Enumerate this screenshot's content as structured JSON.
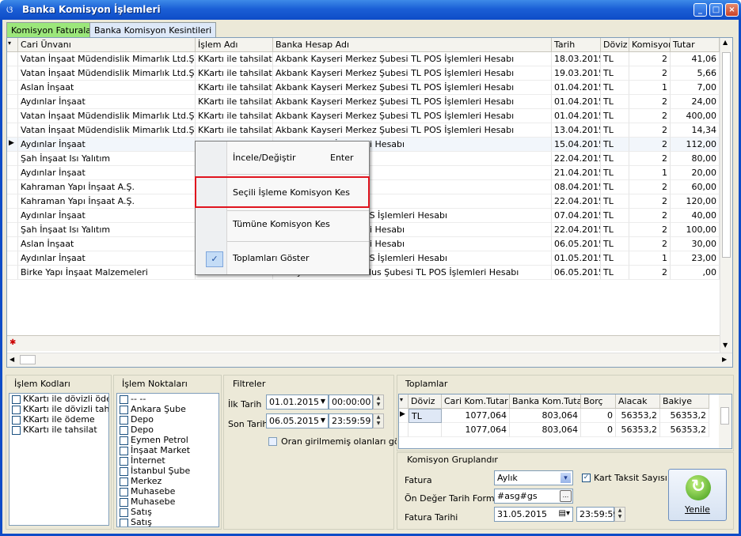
{
  "window": {
    "title": "Banka Komisyon İşlemleri",
    "app_icon": "butterfly-icon",
    "buttons": {
      "minimize": "_",
      "maximize": "□",
      "close": "×"
    }
  },
  "tabs": [
    {
      "label": "Komisyon Faturaları",
      "active": true
    },
    {
      "label": "Banka Komisyon Kesintileri",
      "active": false
    }
  ],
  "grid": {
    "columns": [
      "Cari Ünvanı",
      "İşlem Adı",
      "Banka Hesap Adı",
      "Tarih",
      "Döviz",
      "Komisyon",
      "Tutar"
    ],
    "rows": [
      {
        "cari": "Vatan İnşaat Müdendislik Mimarlık Ltd.Şti",
        "islem": "KKartı ile tahsilat",
        "banka": "Akbank Kayseri Merkez Şubesi TL POS İşlemleri Hesabı",
        "tarih": "18.03.2015",
        "doviz": "TL",
        "komisyon": "2",
        "tutar": "41,06"
      },
      {
        "cari": "Vatan İnşaat Müdendislik Mimarlık Ltd.Şti",
        "islem": "KKartı ile tahsilat",
        "banka": "Akbank Kayseri Merkez Şubesi TL POS İşlemleri Hesabı",
        "tarih": "19.03.2015",
        "doviz": "TL",
        "komisyon": "2",
        "tutar": "5,66"
      },
      {
        "cari": "Aslan İnşaat",
        "islem": "KKartı ile tahsilat",
        "banka": "Akbank Kayseri Merkez Şubesi TL POS İşlemleri Hesabı",
        "tarih": "01.04.2015",
        "doviz": "TL",
        "komisyon": "1",
        "tutar": "7,00"
      },
      {
        "cari": "Aydınlar İnşaat",
        "islem": "KKartı ile tahsilat",
        "banka": "Akbank Kayseri Merkez Şubesi TL POS İşlemleri Hesabı",
        "tarih": "01.04.2015",
        "doviz": "TL",
        "komisyon": "2",
        "tutar": "24,00"
      },
      {
        "cari": "Vatan İnşaat Müdendislik Mimarlık Ltd.Şti",
        "islem": "KKartı ile tahsilat",
        "banka": "Akbank Kayseri Merkez Şubesi TL POS İşlemleri Hesabı",
        "tarih": "01.04.2015",
        "doviz": "TL",
        "komisyon": "2",
        "tutar": "400,00"
      },
      {
        "cari": "Vatan İnşaat Müdendislik Mimarlık Ltd.Şti",
        "islem": "KKartı ile tahsilat",
        "banka": "Akbank Kayseri Merkez Şubesi TL POS İşlemleri Hesabı",
        "tarih": "13.04.2015",
        "doviz": "TL",
        "komisyon": "2",
        "tutar": "14,34"
      },
      {
        "cari": "Aydınlar İnşaat",
        "islem": "",
        "banka": "ubesi TL POS İşlemleri Hesabı",
        "tarih": "15.04.2015",
        "doviz": "TL",
        "komisyon": "2",
        "tutar": "112,00",
        "current": true
      },
      {
        "cari": "Şah İnşaat Isı Yalıtım",
        "islem": "",
        "banka": "lemleri Hesabı",
        "tarih": "22.04.2015",
        "doviz": "TL",
        "komisyon": "2",
        "tutar": "80,00"
      },
      {
        "cari": "Aydınlar İnşaat",
        "islem": "",
        "banka": "lemleri Hesabı",
        "tarih": "21.04.2015",
        "doviz": "TL",
        "komisyon": "1",
        "tutar": "20,00"
      },
      {
        "cari": "Kahraman Yapı İnşaat A.Ş.",
        "islem": "",
        "banka": "lemleri Hesabı",
        "tarih": "08.04.2015",
        "doviz": "TL",
        "komisyon": "2",
        "tutar": "60,00"
      },
      {
        "cari": "Kahraman Yapı İnşaat A.Ş.",
        "islem": "",
        "banka": "İşlemleri Hesabı",
        "tarih": "22.04.2015",
        "doviz": "TL",
        "komisyon": "2",
        "tutar": "120,00"
      },
      {
        "cari": "Aydınlar İnşaat",
        "islem": "",
        "banka": "Ortaköy Şubesi TL POS İşlemleri Hesabı",
        "tarih": "07.04.2015",
        "doviz": "TL",
        "komisyon": "2",
        "tutar": "40,00"
      },
      {
        "cari": "Şah İnşaat Isı Yalıtım",
        "islem": "",
        "banka": "ubesi TL POS İşlemleri Hesabı",
        "tarih": "22.04.2015",
        "doviz": "TL",
        "komisyon": "2",
        "tutar": "100,00"
      },
      {
        "cari": "Aslan İnşaat",
        "islem": "",
        "banka": "ubesi TL POS İşlemleri Hesabı",
        "tarih": "06.05.2015",
        "doviz": "TL",
        "komisyon": "2",
        "tutar": "30,00"
      },
      {
        "cari": "Aydınlar İnşaat",
        "islem": "",
        "banka": "Ortaköy Şubesi TL POS İşlemleri Hesabı",
        "tarih": "01.05.2015",
        "doviz": "TL",
        "komisyon": "1",
        "tutar": "23,00"
      },
      {
        "cari": "Birke Yapı İnşaat Malzemeleri",
        "islem": "KKartı ile tahsilat",
        "banka": "Kuveyt Türk Ankara Ulus Şubesi TL POS İşlemleri Hesabı",
        "tarih": "06.05.2015",
        "doviz": "TL",
        "komisyon": "2",
        "tutar": ",00"
      }
    ]
  },
  "context_menu": {
    "items": [
      {
        "label": "İncele/Değiştir",
        "shortcut": "Enter"
      },
      {
        "label": "Seçili İşleme Komisyon Kes",
        "shortcut": "",
        "highlighted": true
      },
      {
        "label": "Tümüne Komisyon Kes",
        "shortcut": ""
      },
      {
        "label": "Toplamları Göster",
        "shortcut": "",
        "checked": true
      }
    ],
    "check_glyph": "✓"
  },
  "islem_kodlari": {
    "title": "İşlem Kodları",
    "items": [
      "KKartı ile dövizli ödeme",
      "KKartı ile dövizli tahsilat",
      "KKartı ile ödeme",
      "KKartı ile tahsilat"
    ]
  },
  "islem_noktalari": {
    "title": "İşlem Noktaları",
    "items": [
      "-- --",
      "Ankara Şube",
      "Depo",
      "Depo",
      "Eymen Petrol",
      "İnşaat Market",
      "İnternet",
      "İstanbul Şube",
      "Merkez",
      "Muhasebe",
      "Muhasebe",
      "Satış",
      "Satış"
    ]
  },
  "filtreler": {
    "title": "Filtreler",
    "ilk_tarih_label": "İlk Tarih",
    "ilk_tarih": "01.01.2015",
    "ilk_saat": "00:00:00",
    "son_tarih_label": "Son Tarih",
    "son_tarih": "06.05.2015",
    "son_saat": "23:59:59",
    "oran_label": "Oran girilmemiş olanları göster"
  },
  "toplamlar": {
    "title": "Toplamlar",
    "columns": [
      "Döviz",
      "Cari Kom.Tutar",
      "Banka Kom.Tutar",
      "Borç",
      "Alacak",
      "Bakiye"
    ],
    "rows": [
      [
        "TL",
        "1077,064",
        "803,064",
        "0",
        "56353,2",
        "56353,2"
      ],
      [
        "",
        "1077,064",
        "803,064",
        "0",
        "56353,2",
        "56353,2"
      ]
    ]
  },
  "komisyon_grup": {
    "title": "Komisyon Gruplandır",
    "fatura_label": "Fatura",
    "fatura_value": "Aylık",
    "kart_taksit_label": "Kart Taksit Sayısı",
    "on_deger_label": "Ön Değer Tarih Formatı",
    "on_deger_value": "#asg#gs",
    "fatura_tarihi_label": "Fatura Tarihi",
    "fatura_tarihi": "31.05.2015",
    "fatura_saat": "23:59:59",
    "more": "...",
    "refresh_label": "Yenile"
  }
}
